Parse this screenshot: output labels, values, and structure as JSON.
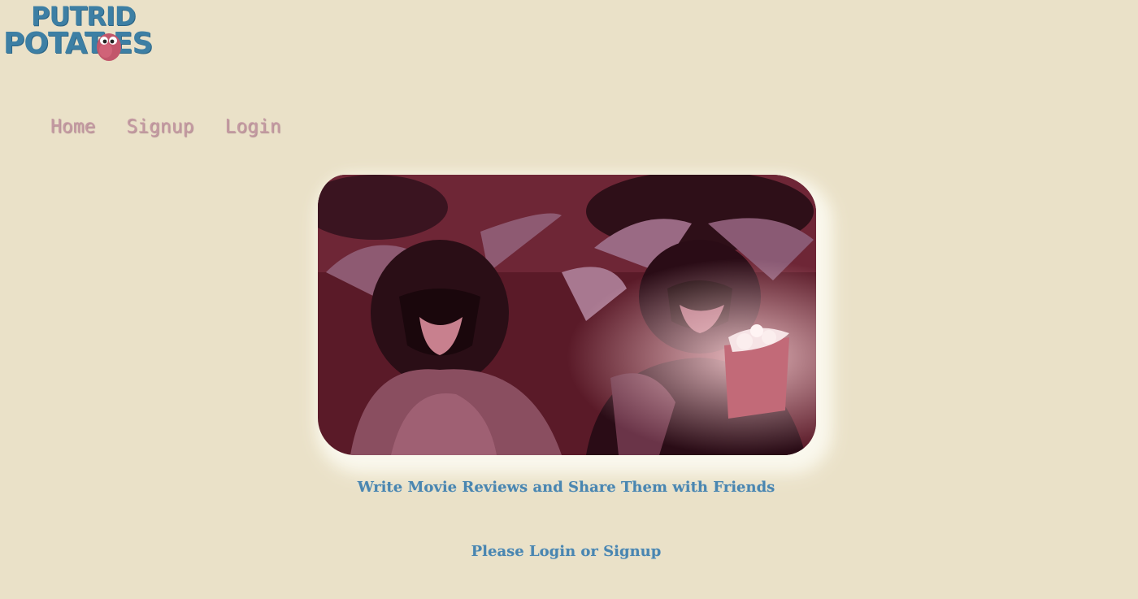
{
  "logo": {
    "line1": "PUTRID",
    "line2": "POTAT  ES",
    "alt": "Putrid Potatoes"
  },
  "nav": {
    "home": "Home",
    "signup": "Signup",
    "login": "Login"
  },
  "hero": {
    "alt": "Gremlins at a movie theater"
  },
  "main": {
    "tagline": "Write Movie Reviews and Share Them with Friends",
    "prompt": "Please Login or Signup"
  },
  "colors": {
    "background": "#eae1c8",
    "logo": "#3d7fa4",
    "nav_link": "#c49aa2",
    "text": "#4a86b0"
  }
}
